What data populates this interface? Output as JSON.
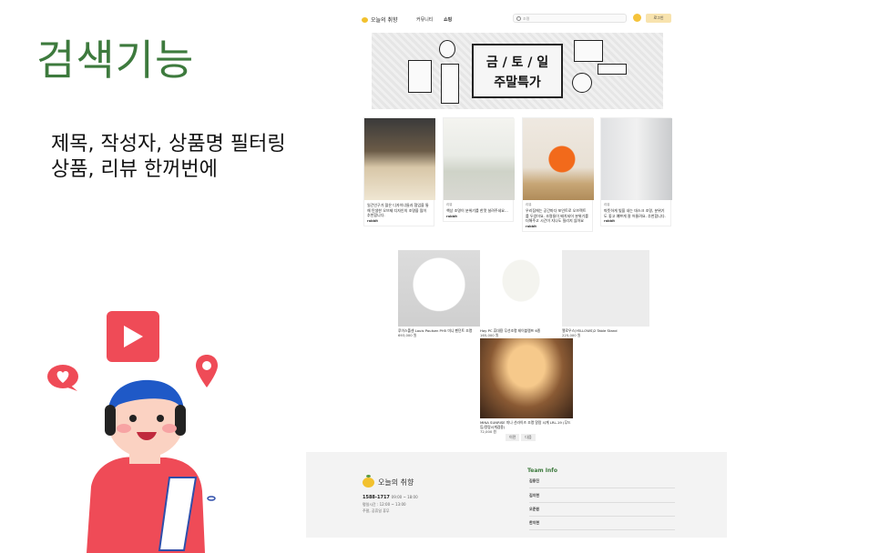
{
  "slide": {
    "title": "검색기능",
    "desc_line1": "제목, 작성자, 상품명 필터링",
    "desc_line2": "상품, 리뷰 한꺼번에"
  },
  "header": {
    "logo_text": "오늘의 취향",
    "nav_community": "커뮤니티",
    "nav_shop": "쇼핑",
    "search_value": "조명",
    "login_label": "로그인"
  },
  "banner": {
    "line1": "금 / 토 / 일",
    "line2": "주말특가"
  },
  "cards": [
    {
      "category": "",
      "text": "일간인구가 많은 디자이너들과 협업을 통해 탄생한 오브제 디자인의 조명을 많이 추천합니다.",
      "user": "rabbit"
    },
    {
      "category": "리뷰",
      "text": "책상 조명이 분위기를 한껏 살려주네요...",
      "user": "rabbit"
    },
    {
      "category": "리뷰",
      "text": "우리집에는 공간마다 포인트로 오브젝트를 두었어요. 조명들이 배치되어 분위기를 더해주고 시간이 지나도 질리지 않아요",
      "user": "rabbit"
    },
    {
      "category": "리뷰",
      "text": "따뜻하게 빛을 내는 데스크 조명, 분위기도 좋고 예쁘게 잘 어울려요. 추천합니다.",
      "user": "rabbit"
    }
  ],
  "products": [
    {
      "name": "루이스폴센 Louis Poulsen PH5 미니 펜던트 조명",
      "price": "693,000 원"
    },
    {
      "name": "Hay PC 휴대용 무선조명 테이블램프 6종",
      "price": "165,000 원"
    },
    {
      "name": "엘로우스(YELLOWS)2 Table Stand",
      "price": "225,000 원"
    },
    {
      "name": "MINA SUNRISE 미나 선라이즈 조명 알람 시계 LRL-19 (무드등/알람시계겸용)",
      "price": "72,000 원"
    }
  ],
  "pager": {
    "prev": "이전",
    "next": "다음"
  },
  "footer": {
    "logo_text": "오늘의 취향",
    "phone": "1588-1717",
    "phone_hours": "09:00 ~ 18:00",
    "hours": "평일시간 : 12:00 ~ 13:00",
    "address": "주말, 공휴일 휴무",
    "team_title": "Team Info",
    "members": [
      "김용진",
      "김지현",
      "오준원",
      "한지현"
    ]
  },
  "colors": {
    "title_green": "#3d7a3d",
    "accent_red": "#ef4b57",
    "lemon": "#f2c12e",
    "login_bg": "#f8e3ae"
  },
  "icons": [
    "play-icon",
    "heart-icon",
    "map-pin-icon",
    "search-icon",
    "smile-icon",
    "lemon-icon"
  ]
}
